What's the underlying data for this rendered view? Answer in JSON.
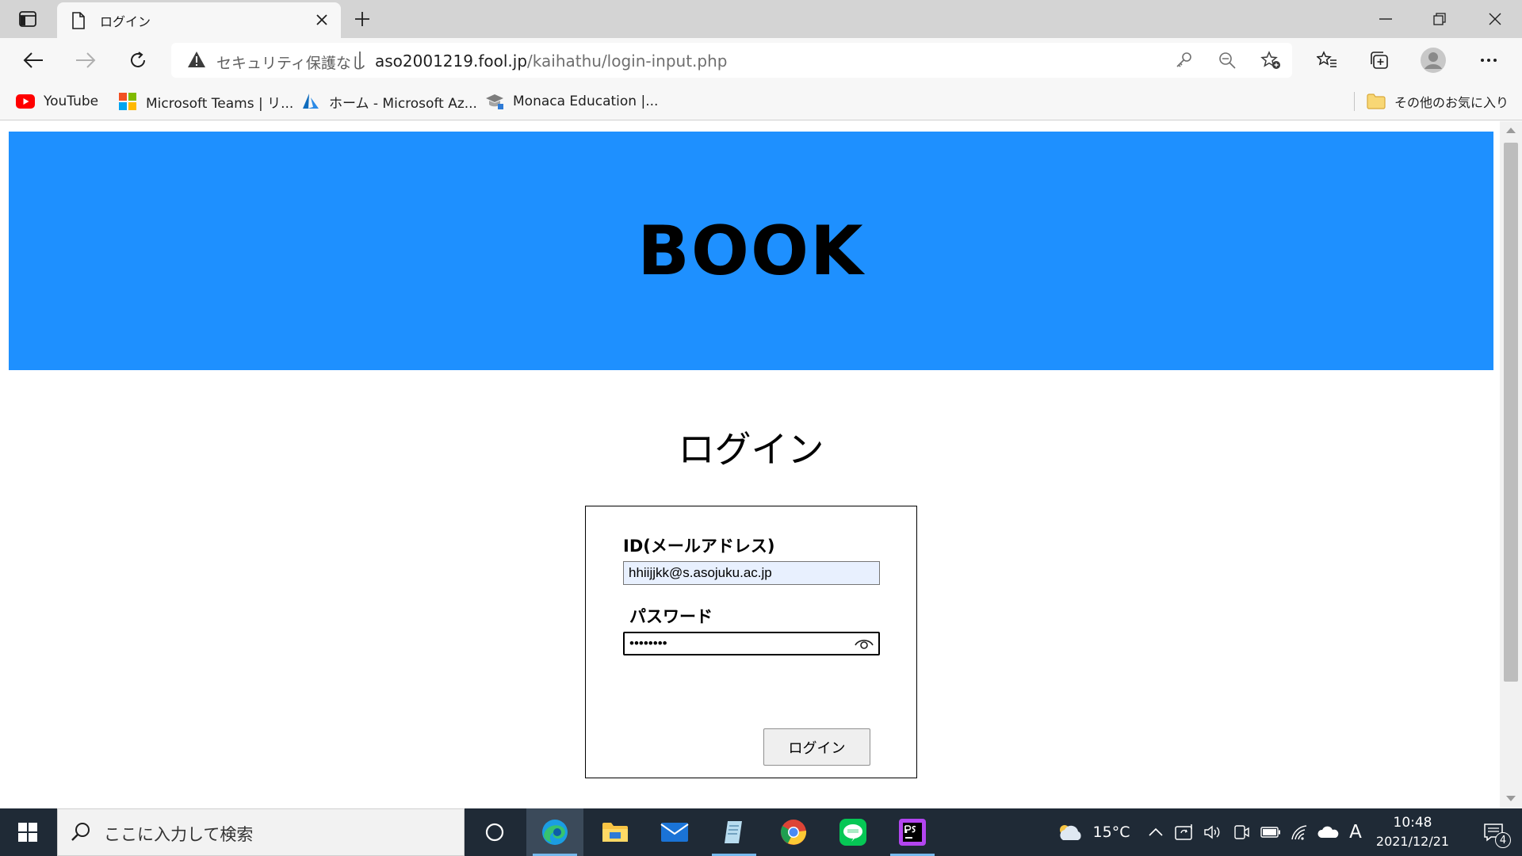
{
  "browser": {
    "tab_title": "ログイン",
    "address": {
      "security_label": "セキュリティ保護なし",
      "url_host": "aso2001219.fool.jp",
      "url_path": "/kaihathu/login-input.php"
    },
    "favorites": [
      {
        "label": "YouTube",
        "icon": "youtube-icon"
      },
      {
        "label": "Microsoft Teams | リ...",
        "icon": "microsoft-icon"
      },
      {
        "label": "ホーム - Microsoft Az...",
        "icon": "azure-icon"
      },
      {
        "label": "Monaca Education |...",
        "icon": "monaca-icon"
      }
    ],
    "other_favorites": "その他のお気に入り"
  },
  "page": {
    "banner_title": "BOOK",
    "heading": "ログイン",
    "form": {
      "id_label": "ID(メールアドレス)",
      "id_value": "hhiijjkk@s.asojuku.ac.jp",
      "password_label": "パスワード",
      "password_value": "••••••••",
      "submit_label": "ログイン"
    }
  },
  "taskbar": {
    "search_placeholder": "ここに入力して検索",
    "weather_temp": "15°C",
    "ime_indicator": "A",
    "time": "10:48",
    "date": "2021/12/21",
    "notification_count": "4"
  },
  "colors": {
    "banner": "#1e90ff",
    "taskbar": "#1f2a36",
    "autofill": "#e8f0fe"
  }
}
